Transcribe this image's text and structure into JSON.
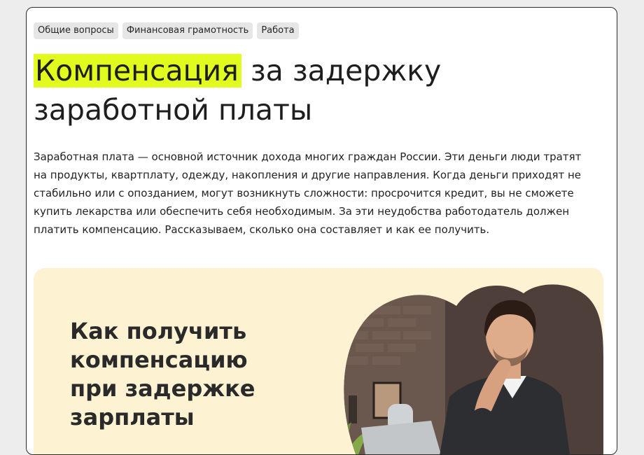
{
  "tags": [
    "Общие вопросы",
    "Финансовая грамотность",
    "Работа"
  ],
  "title": {
    "highlight": "Компенсация",
    "rest": " за задержку заработной платы"
  },
  "lead": "Заработная плата — основной источник дохода многих граждан России. Эти деньги люди тратят на продукты, квартплату, одежду, накопления и другие направления. Когда деньги приходят не стабильно или с опозданием, могут возникнуть сложности: просрочится кредит, вы не сможете купить лекарства или обеспечить себя необходимым. За эти неудобства работодатель должен платить компенсацию. Рассказываем, сколько она составляет и как ее получить.",
  "banner": {
    "lines": [
      "Как получить",
      "компенсацию",
      "при задержке",
      "зарплаты"
    ],
    "photo": "man-at-laptop-photo"
  },
  "colors": {
    "highlight": "#e1fb1f",
    "banner_bg": "#fdf3d3",
    "tag_bg": "#e6e6e6"
  }
}
